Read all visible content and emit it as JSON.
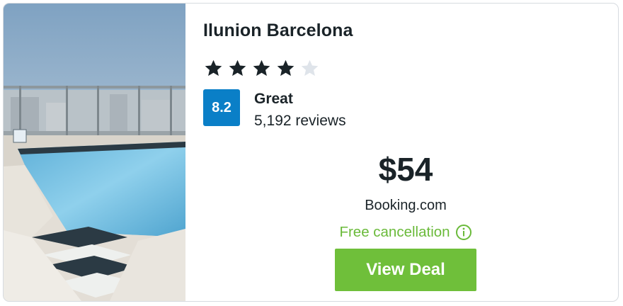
{
  "hotel": {
    "name": "Ilunion Barcelona",
    "stars_filled": 4,
    "stars_total": 5,
    "image_description": "rooftop swimming pool"
  },
  "rating": {
    "score": "8.2",
    "label": "Great",
    "reviews": "5,192 reviews"
  },
  "deal": {
    "price": "$54",
    "provider": "Booking.com",
    "cancellation": "Free cancellation",
    "button_label": "View Deal"
  },
  "colors": {
    "badge": "#0a7fc7",
    "cancellation": "#6aba3a",
    "button": "#6fbf3a",
    "star_filled": "#1a2328",
    "star_empty": "#dfe4ea"
  },
  "icons": {
    "star": "star-icon",
    "info": "info-icon"
  }
}
